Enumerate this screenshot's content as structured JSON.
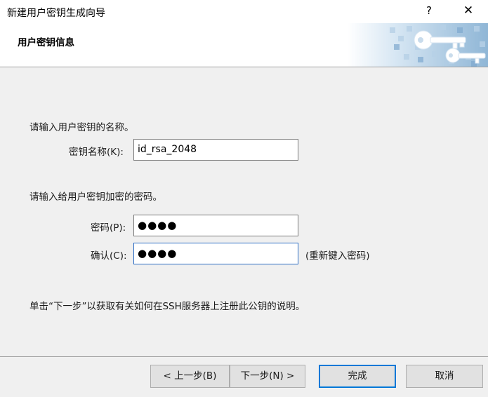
{
  "window": {
    "title": "新建用户密钥生成向导",
    "help_glyph": "?",
    "close_glyph": "✕"
  },
  "header": {
    "heading": "用户密钥信息",
    "art_icon": "keys-icon"
  },
  "form": {
    "name_prompt": "请输入用户密钥的名称。",
    "name_label": "密钥名称(K):",
    "name_value": "id_rsa_2048",
    "password_prompt": "请输入给用户密钥加密的密码。",
    "password_label": "密码(P):",
    "password_value": "●●●●",
    "confirm_label": "确认(C):",
    "confirm_value": "●●●●",
    "confirm_hint": "(重新键入密码)",
    "info_text": "单击“下一步”以获取有关如何在SSH服务器上注册此公钥的说明。"
  },
  "buttons": {
    "back": "< 上一步(B)",
    "next": "下一步(N) >",
    "finish": "完成",
    "cancel": "取消"
  },
  "colors": {
    "accent": "#0078d7",
    "focus_border": "#2b6cc4",
    "banner_art": "#9ec4e4"
  }
}
